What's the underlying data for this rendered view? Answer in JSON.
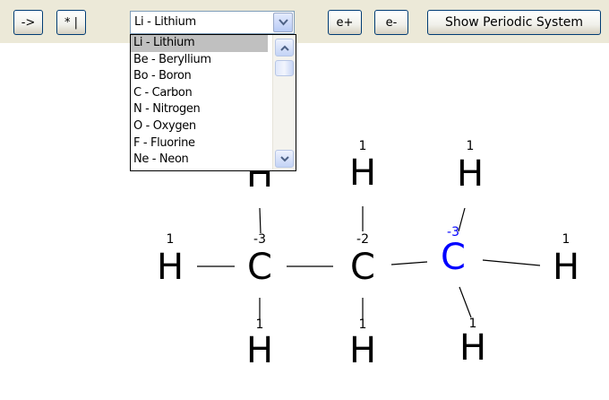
{
  "toolbar": {
    "arrow_label": "->",
    "star_label": "* |",
    "element_selected": "Li - Lithium",
    "e_plus_label": "e+",
    "e_minus_label": "e-",
    "periodic_label": "Show Periodic System"
  },
  "dropdown": {
    "options": [
      "Li - Lithium",
      "Be - Beryllium",
      "Bo - Boron",
      "C - Carbon",
      "N - Nitrogen",
      "O - Oxygen",
      "F - Fluorine",
      "Ne - Neon"
    ],
    "selected_index": 0
  },
  "molecule": {
    "atoms": [
      {
        "id": "h-left",
        "symbol": "H",
        "charge": "1",
        "color": "#000000"
      },
      {
        "id": "c1",
        "symbol": "C",
        "charge": "-3",
        "color": "#000000"
      },
      {
        "id": "c2",
        "symbol": "C",
        "charge": "-2",
        "color": "#000000"
      },
      {
        "id": "c3",
        "symbol": "C",
        "charge": "-3",
        "color": "#0000ff"
      },
      {
        "id": "h-right",
        "symbol": "H",
        "charge": "1",
        "color": "#000000"
      },
      {
        "id": "h-c1-top",
        "symbol": "H",
        "charge": "",
        "color": "#000000"
      },
      {
        "id": "h-c2-top",
        "symbol": "H",
        "charge": "1",
        "color": "#000000"
      },
      {
        "id": "h-c3-top",
        "symbol": "H",
        "charge": "1",
        "color": "#000000"
      },
      {
        "id": "h-c1-bottom",
        "symbol": "H",
        "charge": "1",
        "color": "#000000"
      },
      {
        "id": "h-c2-bottom",
        "symbol": "H",
        "charge": "1",
        "color": "#000000"
      },
      {
        "id": "h-c3-bottom",
        "symbol": "H",
        "charge": "1",
        "color": "#000000"
      }
    ],
    "selected_atom_color": "#0000ff"
  }
}
